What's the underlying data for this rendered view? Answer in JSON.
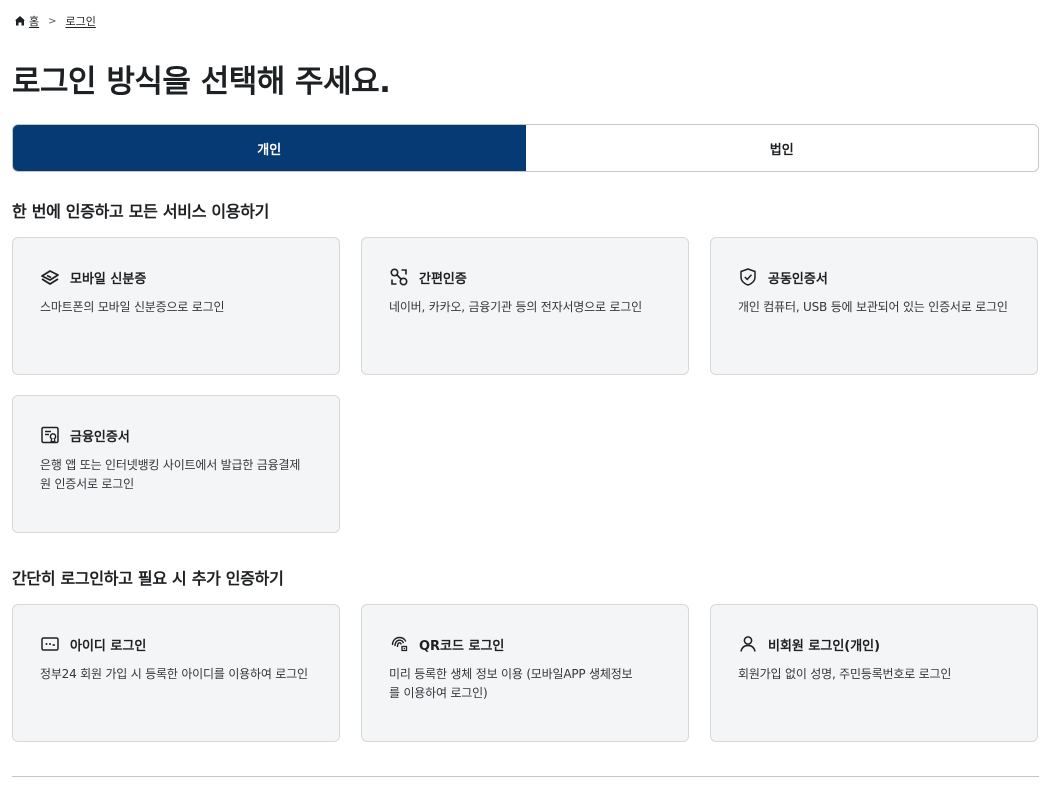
{
  "breadcrumb": {
    "home_label": "홈",
    "current_label": "로그인"
  },
  "page_title": "로그인 방식을 선택해 주세요.",
  "tabs": [
    {
      "label": "개인",
      "active": true
    },
    {
      "label": "법인",
      "active": false
    }
  ],
  "section_all": {
    "title": "한 번에 인증하고 모든 서비스 이용하기",
    "cards": [
      {
        "icon": "id-card-icon",
        "title": "모바일 신분증",
        "desc": "스마트폰의 모바일 신분증으로 로그인"
      },
      {
        "icon": "link-icon",
        "title": "간편인증",
        "desc": "네이버, 카카오, 금융기관 등의 전자서명으로 로그인"
      },
      {
        "icon": "shield-check-icon",
        "title": "공동인증서",
        "desc": "개인 컴퓨터, USB 등에 보관되어 있는 인증서로 로그인"
      },
      {
        "icon": "certificate-icon",
        "title": "금융인증서",
        "desc": "은행 앱 또는 인터넷뱅킹 사이트에서 발급한 금융결제원 인증서로 로그인"
      }
    ]
  },
  "section_simple": {
    "title": "간단히 로그인하고 필요 시 추가 인증하기",
    "cards": [
      {
        "icon": "password-icon",
        "title": "아이디 로그인",
        "desc": "정부24 회원 가입 시 등록한 아이디를 이용하여 로그인"
      },
      {
        "icon": "fingerprint-icon",
        "title": "QR코드 로그인",
        "desc": "미리 등록한 생체 정보 이용 (모바일APP 생체정보를 이용하여 로그인)"
      },
      {
        "icon": "user-icon",
        "title": "비회원 로그인(개인)",
        "desc": "회원가입 없이 성명, 주민등록번호로 로그인"
      }
    ]
  }
}
